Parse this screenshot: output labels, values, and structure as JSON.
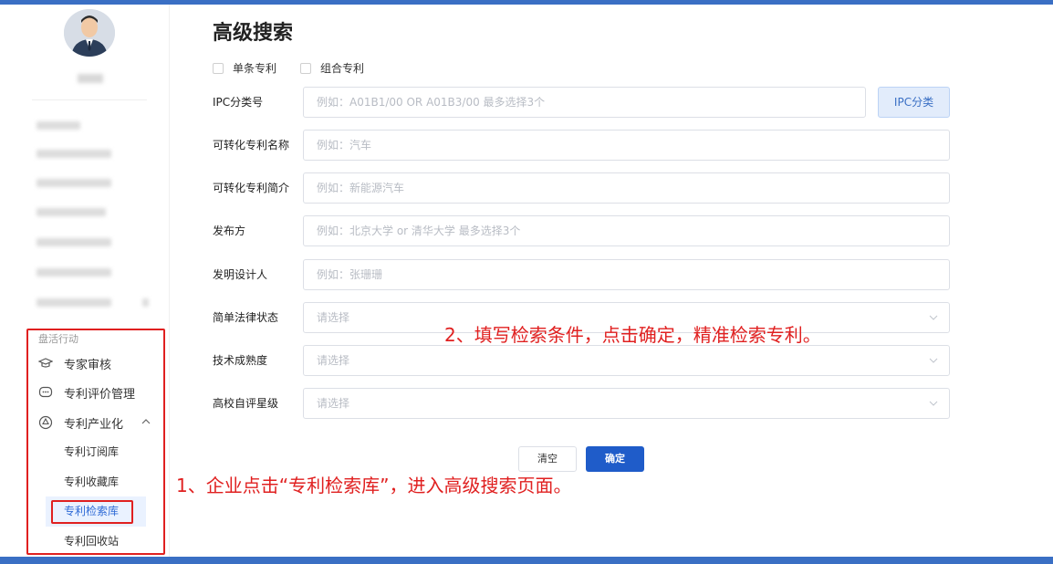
{
  "sidebar": {
    "group_label": "盘活行动",
    "menu": [
      {
        "label": "专家审核",
        "icon": "graduation-cap-icon"
      },
      {
        "label": "专利评价管理",
        "icon": "chat-bubble-icon"
      },
      {
        "label": "专利产业化",
        "icon": "hexagon-badge-icon",
        "expanded": true
      }
    ],
    "sub_items": [
      "专利订阅库",
      "专利收藏库",
      "专利检索库",
      "专利回收站"
    ],
    "active_sub_item": "专利检索库"
  },
  "main": {
    "title": "高级搜索",
    "checkboxes": [
      {
        "label": "单条专利",
        "checked": false
      },
      {
        "label": "组合专利",
        "checked": false
      }
    ],
    "fields": [
      {
        "label": "IPC分类号",
        "placeholder": "例如：A01B1/00 OR A01B3/00  最多选择3个",
        "type": "text"
      },
      {
        "label": "可转化专利名称",
        "placeholder": "例如：汽车",
        "type": "text"
      },
      {
        "label": "可转化专利简介",
        "placeholder": "例如：新能源汽车",
        "type": "text"
      },
      {
        "label": "发布方",
        "placeholder": "例如：北京大学 or 清华大学 最多选择3个",
        "type": "text"
      },
      {
        "label": "发明设计人",
        "placeholder": "例如：张珊珊",
        "type": "text"
      },
      {
        "label": "简单法律状态",
        "placeholder": "请选择",
        "type": "select"
      },
      {
        "label": "技术成熟度",
        "placeholder": "请选择",
        "type": "select"
      },
      {
        "label": "高校自评星级",
        "placeholder": "请选择",
        "type": "select"
      }
    ],
    "ipc_button": "IPC分类",
    "clear_button": "清空",
    "confirm_button": "确定"
  },
  "annotations": {
    "step1": "1、企业点击“专利检索库”，进入高级搜索页面。",
    "step2": "2、填写检索条件，点击确定，精准检索专利。"
  },
  "colors": {
    "accent": "#1f5cc9",
    "annotation_red": "#e02020",
    "top_bar": "#3a6fc4"
  }
}
